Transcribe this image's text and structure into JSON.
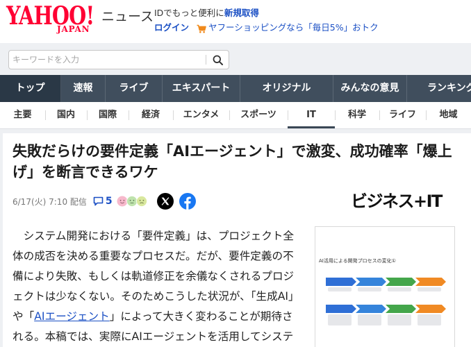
{
  "colors": {
    "brand_red": "#ff0033",
    "link_blue": "#1a4fc4",
    "nav_bg": "#404e5d",
    "nav_selected_bg": "#2a3846",
    "cart_orange": "#f08a1c",
    "facebook_blue": "#1877f2",
    "x_black": "#000000"
  },
  "header": {
    "logo_text": "YAHOO!",
    "logo_sub": "JAPAN",
    "service_name": "ニュース",
    "id_promo": "IDでもっと便利に",
    "signup": "新規取得",
    "login": "ログイン",
    "shopping_promo": "ヤフーショッピングなら「毎日5%」おトク"
  },
  "search": {
    "placeholder": "キーワードを入力"
  },
  "global_nav": {
    "items": [
      {
        "label": "トップ",
        "selected": true
      },
      {
        "label": "速報",
        "selected": false
      },
      {
        "label": "ライブ",
        "selected": false
      },
      {
        "label": "エキスパート",
        "selected": false
      },
      {
        "label": "オリジナル",
        "selected": false
      },
      {
        "label": "みんなの意見",
        "selected": false
      },
      {
        "label": "ランキング",
        "selected": false
      }
    ]
  },
  "category_nav": {
    "items": [
      {
        "label": "主要",
        "selected": false
      },
      {
        "label": "国内",
        "selected": false
      },
      {
        "label": "国際",
        "selected": false
      },
      {
        "label": "経済",
        "selected": false
      },
      {
        "label": "エンタメ",
        "selected": false
      },
      {
        "label": "スポーツ",
        "selected": false
      },
      {
        "label": "IT",
        "selected": true
      },
      {
        "label": "科学",
        "selected": false
      },
      {
        "label": "ライフ",
        "selected": false
      },
      {
        "label": "地域",
        "selected": false
      }
    ]
  },
  "article": {
    "title_lines": [
      "失敗だらけの要件定義「AIエージェント」で激変、成功確率「爆上",
      "げ」を断言できるワケ"
    ],
    "published": "6/17(火) 7:10 配信",
    "comment_count": "5",
    "publisher": "ビジネス+IT",
    "body_lines": [
      [
        {
          "text": "　システム開発における「要件定義」は、プロジェクト全"
        }
      ],
      [
        {
          "text": "体の成否を決める重要なプロセスだ。だが、要件定義の不"
        }
      ],
      [
        {
          "text": "備により失敗、もしくは軌道修正を余儀なくされるプロジ"
        }
      ],
      [
        {
          "text": "ェクトは少なくない。そのためこうした状況が、「生成AI」"
        }
      ],
      [
        {
          "text": "や「"
        },
        {
          "text": "AIエージェント",
          "link": true
        },
        {
          "text": "」によって大きく変わることが期待さ"
        }
      ],
      [
        {
          "text": "れる。本稿では、実際にAIエージェントを活用してシステ"
        }
      ]
    ]
  },
  "figure": {
    "title": "AI活用による開発プロセスの変化①",
    "stage_colors": [
      "#2f6fd6",
      "#3584db",
      "#44a64b",
      "#f08a24"
    ]
  },
  "icons": {
    "search": "search-icon",
    "cart": "cart-icon",
    "comment": "comment-icon",
    "reactions": "reaction-faces-icon",
    "x": "x-logo-icon",
    "facebook": "facebook-icon"
  }
}
